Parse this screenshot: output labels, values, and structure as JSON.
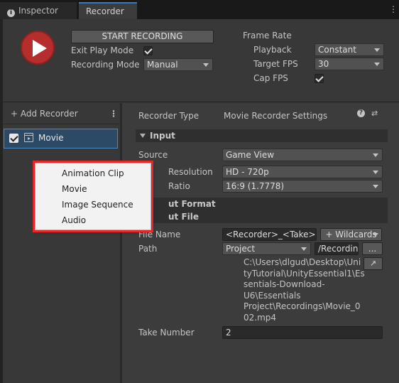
{
  "tabs": {
    "inspector": "Inspector",
    "recorder": "Recorder",
    "inspector_icon": "info-icon"
  },
  "top": {
    "start_recording": "START RECORDING",
    "exit_play_mode_label": "Exit Play Mode",
    "exit_play_mode_checked": true,
    "recording_mode_label": "Recording Mode",
    "recording_mode_value": "Manual",
    "frame_rate_label": "Frame Rate",
    "playback_label": "Playback",
    "playback_value": "Constant",
    "target_fps_label": "Target FPS",
    "target_fps_value": "30",
    "cap_fps_label": "Cap FPS",
    "cap_fps_checked": true
  },
  "list": {
    "add_recorder": "+ Add Recorder",
    "kebab": "⋮",
    "items": [
      {
        "label": "Movie",
        "enabled": true,
        "icon": "movie-icon"
      }
    ]
  },
  "settings": {
    "recorder_type_label": "Recorder Type",
    "recorder_type_value": "Movie Recorder Settings",
    "input_section": "Input",
    "source_label": "Source",
    "source_value": "Game View",
    "output_resolution_label": "Resolution",
    "output_resolution_value": "HD - 720p",
    "aspect_ratio_label": "Ratio",
    "aspect_ratio_value": "16:9 (1.7778)",
    "output_format_section": "ut Format",
    "output_file_section": "ut File",
    "file_name_label": "File Name",
    "file_name_value": "<Recorder>_<Take>",
    "wildcards_label": "+ Wildcards",
    "path_label": "Path",
    "path_root_value": "Project",
    "path_value": "/Recordin",
    "browse_label": "...",
    "resolved_path_lines": [
      "C:\\Users\\dlgud\\Desktop\\Uni",
      "tyTutorial\\UnityEssential1\\Es",
      "sentials-Download-",
      "U6\\Essentials",
      "Project\\Recordings\\Movie_0",
      "02.mp4"
    ],
    "take_number_label": "Take Number",
    "take_number_value": "2"
  },
  "context_menu": {
    "items": [
      "Animation Clip",
      "Movie",
      "Image Sequence",
      "Audio"
    ],
    "highlight_color": "#e8262a"
  },
  "colors": {
    "record_button": "#b62d2d",
    "selection": "#2c4a65",
    "selection_border": "#4b89c1",
    "tab_accent": "#3a79bb"
  }
}
